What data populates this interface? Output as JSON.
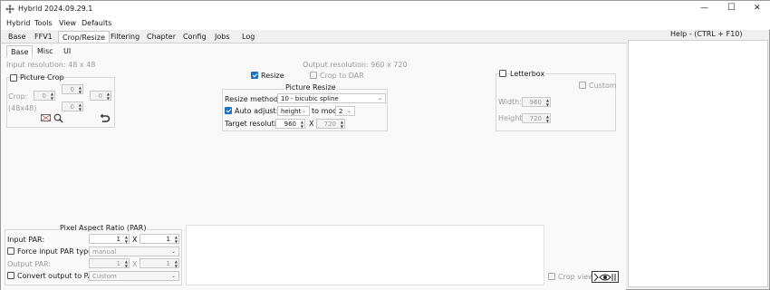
{
  "window": {
    "title": "Hybrid 2024.09.29.1",
    "controls": {
      "minimize": "—",
      "maximize": "☐",
      "close": "✕"
    }
  },
  "menu": [
    "Hybrid",
    "Tools",
    "View",
    "Defaults"
  ],
  "main_tabs": [
    "Base",
    "FFV1",
    "Crop/Resize",
    "Filtering",
    "Chapter",
    "Config",
    "Jobs",
    "Log"
  ],
  "main_tab_active": "Crop/Resize",
  "sub_tabs": [
    "Base",
    "Misc",
    "UI"
  ],
  "sub_tab_active": "Base",
  "input_resolution": "Input resolution: 48 x 48",
  "output_resolution": "Output resolution: 960 x 720",
  "picture_crop": {
    "label": "Picture Crop",
    "checked": false,
    "crop_label": "Crop:",
    "size_label": "(48x48)",
    "top": "0",
    "left": "0",
    "right": "0",
    "bottom": "0"
  },
  "resize": {
    "resize_label": "Resize",
    "resize_checked": true,
    "crop_to_dar_label": "Crop to DAR",
    "crop_to_dar_checked": false,
    "group_title": "Picture Resize",
    "method_label": "Resize method:",
    "method_value": "10 - bicubic spline",
    "auto_adjust_label": "Auto adjust:",
    "auto_adjust_checked": true,
    "auto_adjust_value": "height",
    "to_mod_label": "to mod",
    "mod_value": "2",
    "target_label": "Target resolution:",
    "target_w": "960",
    "x_label": "X",
    "target_h": "720"
  },
  "letterbox": {
    "label": "Letterbox",
    "checked": false,
    "custom_label": "Custom",
    "width_label": "Width:",
    "width_value": "960",
    "height_label": "Height:",
    "height_value": "720"
  },
  "par": {
    "title": "Pixel Aspect Ratio (PAR)",
    "input_label": "Input PAR:",
    "input_a": "1",
    "input_b": "1",
    "x_label": "X",
    "force_label": "Force input PAR type:",
    "force_value": "manual",
    "output_label": "Output PAR:",
    "output_a": "1",
    "output_b": "1",
    "convert_label": "Convert output to PAR:",
    "convert_value": "Custom"
  },
  "crop_view_label": "Crop view",
  "help_title": "Help - (CTRL + F10)"
}
